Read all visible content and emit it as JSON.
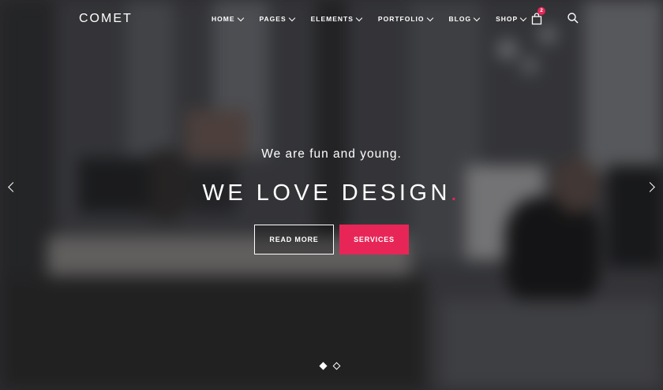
{
  "brand": {
    "logo_text": "COMET"
  },
  "nav": {
    "items": [
      {
        "label": "HOME"
      },
      {
        "label": "PAGES"
      },
      {
        "label": "ELEMENTS"
      },
      {
        "label": "PORTFOLIO"
      },
      {
        "label": "BLOG"
      },
      {
        "label": "SHOP"
      }
    ],
    "cart_icon": "shopping-bag-icon",
    "cart_count": "2",
    "search_icon": "search-icon"
  },
  "hero": {
    "subtitle": "We are fun and young.",
    "title": "WE LOVE DESIGN",
    "title_dot": ".",
    "primary_button": "READ MORE",
    "secondary_button": "SERVICES"
  },
  "slider": {
    "prev_icon": "chevron-left-icon",
    "next_icon": "chevron-right-icon",
    "slide_count": 2,
    "active_slide": 1
  },
  "colors": {
    "accent": "#e72657",
    "text": "#ffffff"
  }
}
